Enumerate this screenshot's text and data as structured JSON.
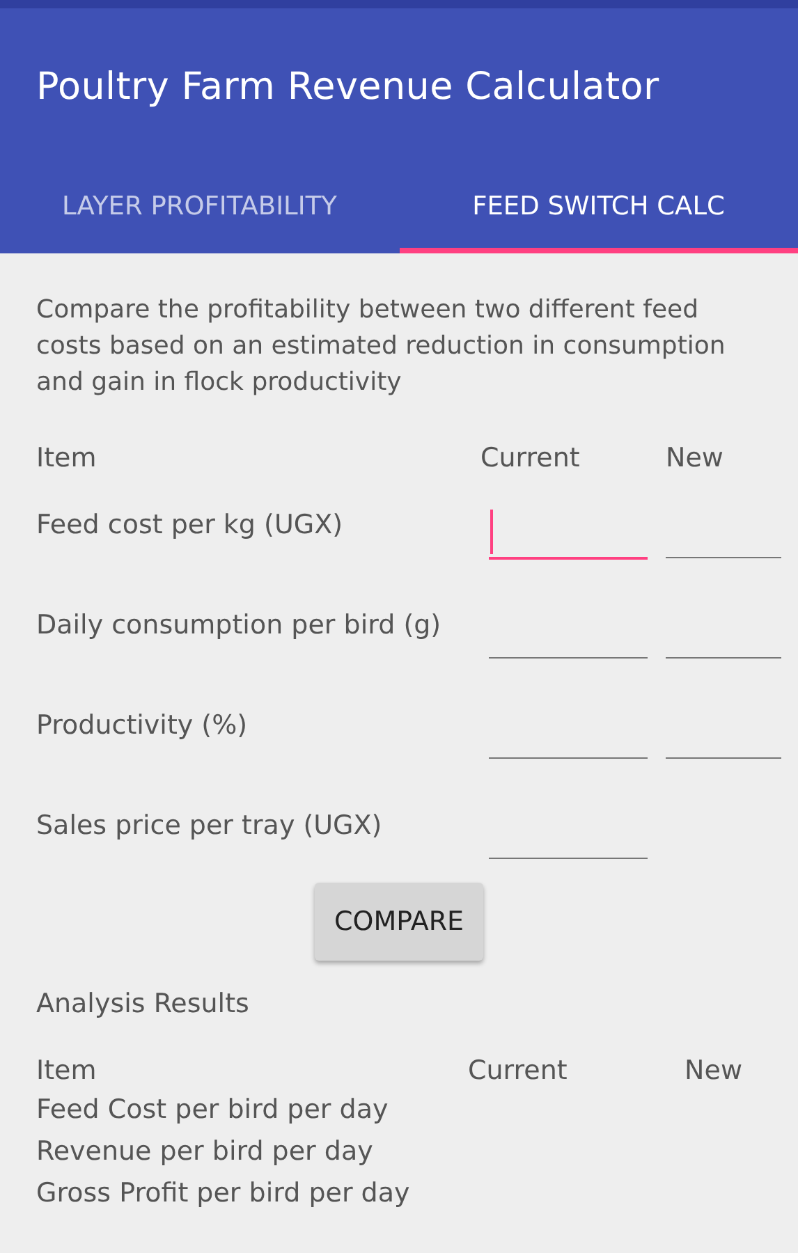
{
  "app_bar": {
    "title": "Poultry Farm Revenue Calculator"
  },
  "tabs": [
    {
      "label": "LAYER PROFITABILITY",
      "selected": false
    },
    {
      "label": "FEED SWITCH CALC",
      "selected": true
    }
  ],
  "description": "Compare the profitability between two different feed costs based on an estimated reduction in consumption and gain in flock productivity",
  "form": {
    "columns": [
      "Item",
      "Current",
      "New"
    ],
    "rows": [
      {
        "label": "Feed cost per kg (UGX)",
        "fields": [
          {
            "focused": true
          },
          {
            "focused": false
          }
        ]
      },
      {
        "label": "Daily consumption per bird (g)",
        "fields": [
          {
            "focused": false
          },
          {
            "focused": false
          }
        ]
      },
      {
        "label": "Productivity (%)",
        "fields": [
          {
            "focused": false
          },
          {
            "focused": false
          }
        ]
      },
      {
        "label": "Sales price per tray (UGX)",
        "fields": [
          {
            "focused": false
          }
        ]
      }
    ]
  },
  "compare_button": "COMPARE",
  "results": {
    "title": "Analysis Results",
    "columns": [
      "Item",
      "Current",
      "New"
    ],
    "rows": [
      "Feed Cost per bird per day",
      "Revenue per bird per day",
      "Gross Profit per bird per day"
    ]
  }
}
